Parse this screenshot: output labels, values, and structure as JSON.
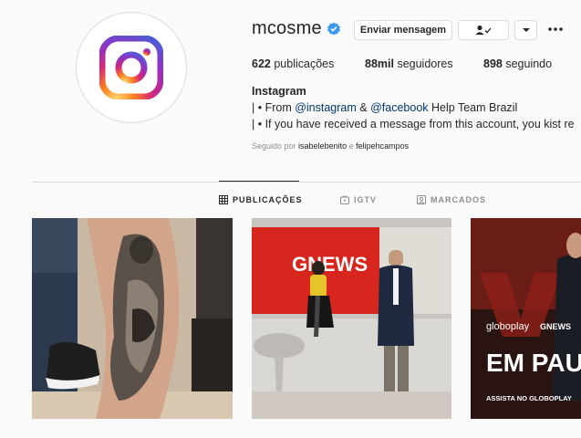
{
  "profile": {
    "username": "mcosme",
    "stats": {
      "posts_count": "622",
      "posts_label": "publicações",
      "followers_count": "88mil",
      "followers_label": "seguidores",
      "following_count": "898",
      "following_label": "seguindo"
    },
    "bio": {
      "name": "Instagram",
      "line1_prefix": "| • From ",
      "line1_link1": "@instagram",
      "line1_amp": " & ",
      "line1_link2": "@facebook",
      "line1_suffix": " Help Team Brazil",
      "line2": "| • If you have received a message from this account, you kist re"
    },
    "followed_by": {
      "prefix": "Seguido por ",
      "user1": "isabelebenito",
      "sep": " e ",
      "user2": "felipehcampos"
    }
  },
  "actions": {
    "message_label": "Enviar mensagem",
    "following_icon": "person-check-icon",
    "dropdown_icon": "chevron-down-icon",
    "more_icon": "more-horizontal-icon"
  },
  "tabs": [
    {
      "label": "PUBLICAÇÕES",
      "icon": "grid-icon",
      "active": true
    },
    {
      "label": "IGTV",
      "icon": "igtv-icon",
      "active": false
    },
    {
      "label": "MARCADOS",
      "icon": "tagged-icon",
      "active": false
    }
  ],
  "posts": [
    {
      "kind": "tattoo-photo"
    },
    {
      "kind": "news-studio-photo",
      "texts": [
        "GNEWS"
      ]
    },
    {
      "kind": "globoplay-promo",
      "texts": [
        "globoplay",
        "GNEWS",
        "EM PAU",
        "ASSISTA NO GLOBOPLAY"
      ]
    }
  ],
  "colors": {
    "verified": "#3897f0",
    "link": "#00376b",
    "news_red": "#d7261e"
  }
}
